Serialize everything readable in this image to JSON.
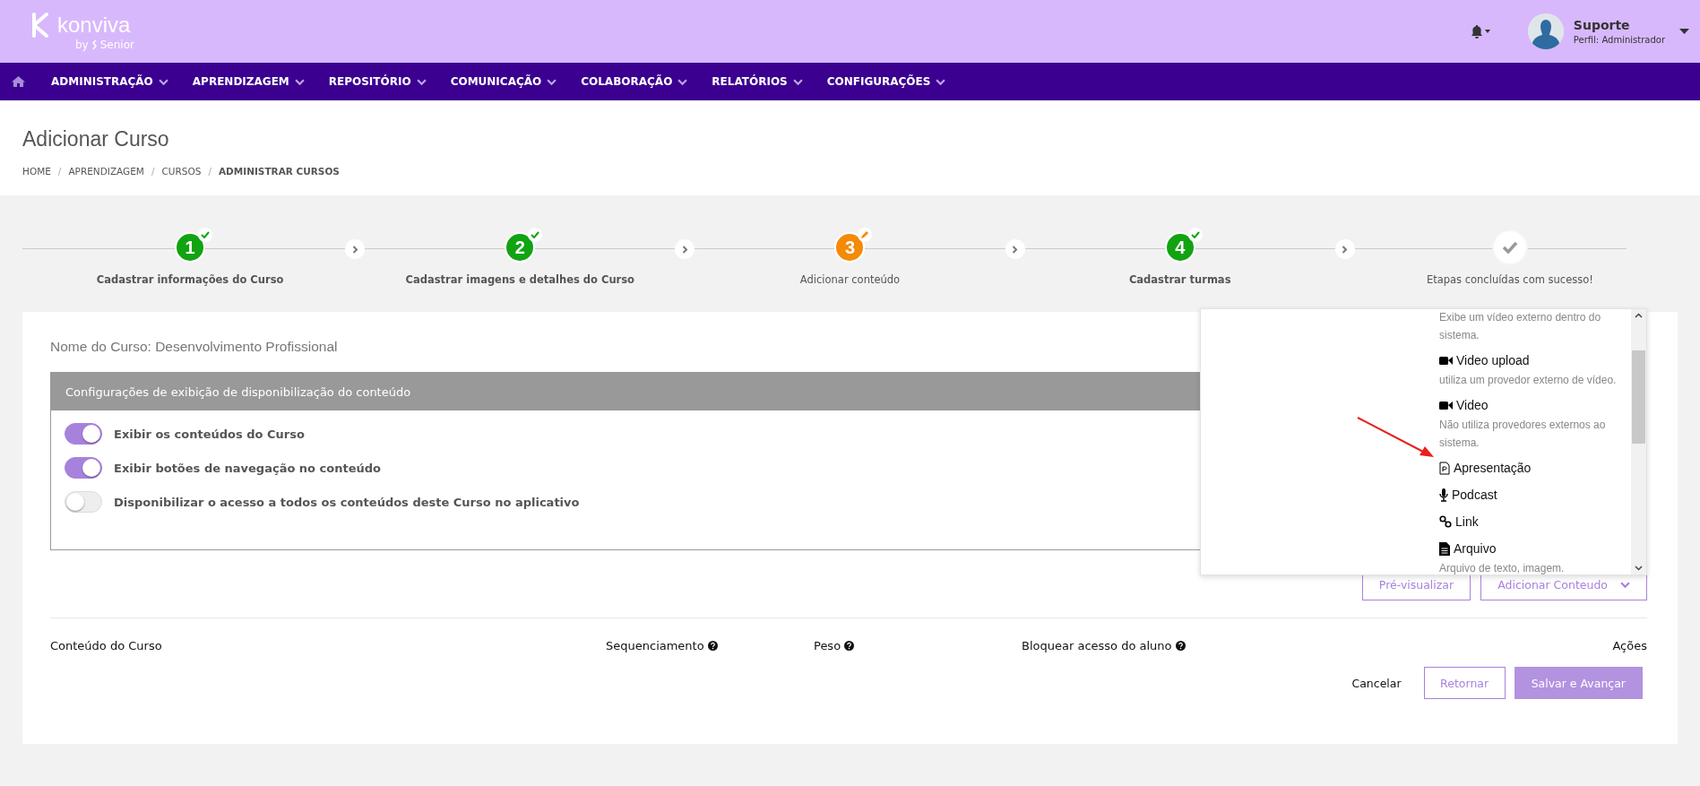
{
  "header": {
    "logo": "konviva",
    "logo_sub": "by",
    "logo_brand": "Senior",
    "user": {
      "name": "Suporte",
      "profile": "Perfil: Administrador"
    }
  },
  "nav": [
    "ADMINISTRAÇÃO",
    "APRENDIZAGEM",
    "REPOSITÓRIO",
    "COMUNICAÇÃO",
    "COLABORAÇÃO",
    "RELATÓRIOS",
    "CONFIGURAÇÕES"
  ],
  "page": {
    "title": "Adicionar Curso",
    "breadcrumb": [
      {
        "label": "HOME",
        "current": false
      },
      {
        "separator": "/",
        "label": "APRENDIZAGEM",
        "current": false
      },
      {
        "separator": "/",
        "label": "CURSOS",
        "current": false
      },
      {
        "separator": "/",
        "label": "ADMINISTRAR CURSOS",
        "current": true
      }
    ]
  },
  "steps": [
    {
      "kind": "done",
      "number": "1",
      "label": "Cadastrar informações do Curso"
    },
    {
      "kind": "done",
      "number": "2",
      "label": "Cadastrar imagens e detalhes do Curso"
    },
    {
      "kind": "current",
      "number": "3",
      "label": "Adicionar conteúdo"
    },
    {
      "kind": "done",
      "number": "4",
      "label": "Cadastrar turmas"
    },
    {
      "kind": "final",
      "label": "Etapas concluídas com sucesso!"
    }
  ],
  "course_name": "Nome do Curso: Desenvolvimento Profissional",
  "settings": {
    "title": "Configurações de exibição de disponibilização do conteúdo",
    "toggles": [
      {
        "label": "Exibir os conteúdos do Curso",
        "on": true
      },
      {
        "label": "Exibir botões de navegação no conteúdo",
        "on": true
      },
      {
        "label": "Disponibilizar o acesso a todos os conteúdos deste Curso no aplicativo",
        "on": false
      }
    ]
  },
  "dropdown": {
    "items": [
      {
        "description": "Exibe um vídeo externo dentro do sistema."
      },
      {
        "kind": "video",
        "label": "Video upload",
        "description": "utiliza um provedor externo de vídeo."
      },
      {
        "kind": "video",
        "label": "Video",
        "description": "Não utiliza provedores externos ao sistema."
      },
      {
        "kind": "presentation",
        "label": "Apresentação"
      },
      {
        "kind": "audio",
        "label": "Podcast"
      },
      {
        "kind": "link",
        "label": "Link"
      },
      {
        "kind": "file",
        "label": "Arquivo",
        "description": "Arquivo de texto, imagem."
      }
    ]
  },
  "buttons": {
    "preview": "Pré-visualizar",
    "add": "Adicionar Conteudo"
  },
  "table": {
    "columns": [
      {
        "label": "Conteúdo do Curso",
        "help": false
      },
      {
        "label": "Sequenciamento",
        "help": true
      },
      {
        "label": "Peso",
        "help": true
      },
      {
        "label": "Bloquear acesso do aluno",
        "help": true
      },
      {
        "label": "Ações",
        "help": false
      }
    ]
  },
  "actions": {
    "cancel": "Cancelar",
    "back": "Retornar",
    "save": "Salvar e Avançar"
  }
}
